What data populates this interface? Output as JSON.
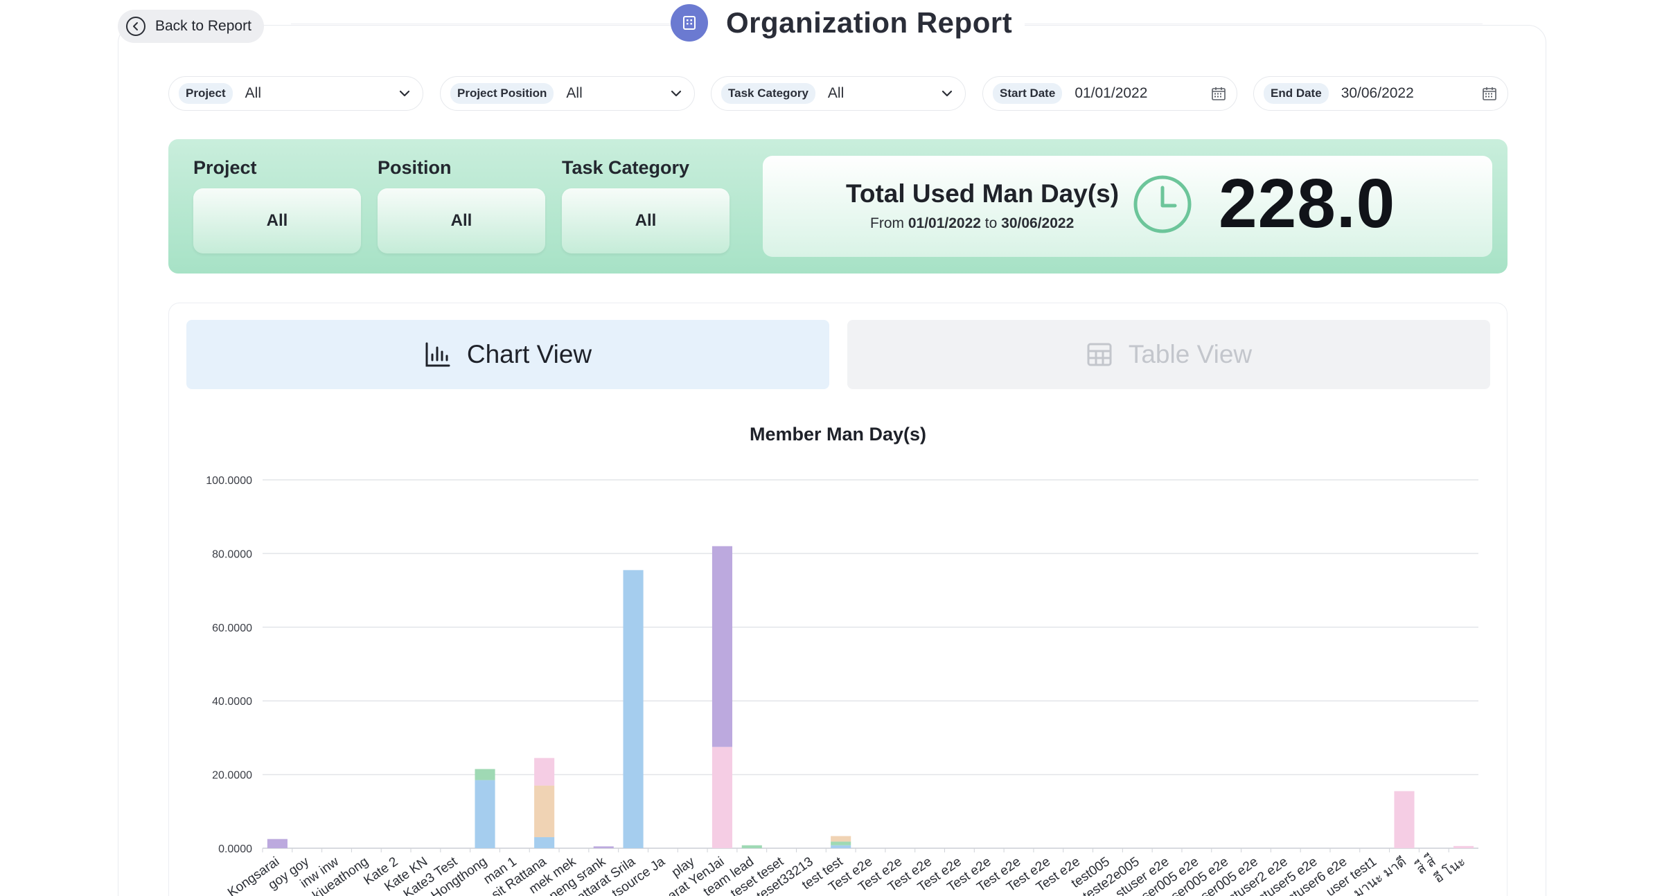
{
  "header": {
    "back_label": "Back to Report",
    "title": "Organization Report"
  },
  "filters": [
    {
      "label": "Project",
      "value": "All"
    },
    {
      "label": "Project Position",
      "value": "All"
    },
    {
      "label": "Task Category",
      "value": "All"
    },
    {
      "label": "Start Date",
      "value": "01/01/2022"
    },
    {
      "label": "End Date",
      "value": "30/06/2022"
    }
  ],
  "summary": {
    "project_label": "Project",
    "project_value": "All",
    "position_label": "Position",
    "position_value": "All",
    "category_label": "Task Category",
    "category_value": "All",
    "total_title": "Total Used Man Day(s)",
    "from_label": "From",
    "from_date": "01/01/2022",
    "to_label": "to",
    "to_date": "30/06/2022",
    "total_value": "228.0"
  },
  "views": {
    "chart_label": "Chart View",
    "table_label": "Table View",
    "active": "chart"
  },
  "colors": {
    "accent_blue": "#6b7ad1",
    "summary_green": "#a7e2c6",
    "clock_green": "#6cc59a"
  },
  "chart_data": {
    "type": "bar",
    "stacked": true,
    "title": "Member Man Day(s)",
    "ylim": [
      0,
      100
    ],
    "yticks": [
      "100.0000",
      "80.0000",
      "60.0000",
      "40.0000",
      "20.0000",
      "0.0000"
    ],
    "grid": true,
    "categories": [
      "Kongsarai",
      "goy goy",
      "inw inw",
      "kjueathong",
      "Kate 2",
      "Kate KN",
      "Kate3 Test",
      "Hongthong",
      "man 1",
      "sit Rattana",
      "mek mek",
      "neng srank",
      "attarat Srila",
      "tsource Ja",
      "play",
      "arat YenJai",
      "team lead",
      "teset teset",
      "teset33213",
      "test test",
      "Test e2e",
      "Test e2e",
      "Test e2e",
      "Test e2e",
      "Test e2e",
      "Test e2e",
      "Test e2e",
      "Test e2e",
      "test005",
      "teste2e005",
      "stuser e2e",
      "ser005 e2e",
      "ser005 e2e",
      "ser005 e2e",
      "ctuser2 e2e",
      "ctuser5 e2e",
      "ctuser6 e2e",
      "user test1",
      "มานะ มาดี",
      "ส่ี ส่ี",
      "อี โนะ"
    ],
    "series": [
      {
        "color": "#a5cdee",
        "values": [
          0,
          0,
          0,
          0,
          0,
          0,
          0,
          18.5,
          0,
          3,
          0,
          0,
          75.5,
          0,
          0,
          0,
          0,
          0,
          0,
          0.8,
          0,
          0,
          0,
          0,
          0,
          0,
          0,
          0,
          0,
          0,
          0,
          0,
          0,
          0,
          0,
          0,
          0,
          0,
          0,
          0,
          0
        ]
      },
      {
        "color": "#9fd9b4",
        "values": [
          0,
          0,
          0,
          0,
          0,
          0,
          0,
          3,
          0,
          0,
          0,
          0,
          0,
          0,
          0,
          0,
          0.8,
          0,
          0,
          1,
          0,
          0,
          0,
          0,
          0,
          0,
          0,
          0,
          0,
          0,
          0,
          0,
          0,
          0,
          0,
          0,
          0,
          0,
          0,
          0,
          0
        ]
      },
      {
        "color": "#f0d3b4",
        "values": [
          0,
          0,
          0,
          0,
          0,
          0,
          0,
          0,
          0,
          14,
          0,
          0,
          0,
          0,
          0,
          0,
          0,
          0,
          0,
          1.5,
          0,
          0,
          0,
          0,
          0,
          0,
          0,
          0,
          0,
          0,
          0,
          0,
          0,
          0,
          0,
          0,
          0,
          0,
          0,
          0,
          0
        ]
      },
      {
        "color": "#f5cde4",
        "values": [
          0,
          0,
          0,
          0,
          0,
          0,
          0,
          0,
          0,
          7.5,
          0,
          0,
          0,
          0,
          0,
          27.5,
          0,
          0,
          0,
          0,
          0,
          0,
          0,
          0,
          0,
          0,
          0,
          0,
          0,
          0,
          0,
          0,
          0,
          0,
          0,
          0,
          0,
          0,
          15.5,
          0,
          0.6
        ]
      },
      {
        "color": "#bca9de",
        "values": [
          2.5,
          0,
          0,
          0,
          0,
          0,
          0,
          0,
          0,
          0,
          0,
          0.5,
          0,
          0,
          0,
          54.5,
          0,
          0,
          0,
          0,
          0,
          0,
          0,
          0,
          0,
          0,
          0,
          0,
          0,
          0,
          0,
          0,
          0,
          0,
          0,
          0,
          0,
          0,
          0,
          0,
          0
        ]
      }
    ]
  }
}
